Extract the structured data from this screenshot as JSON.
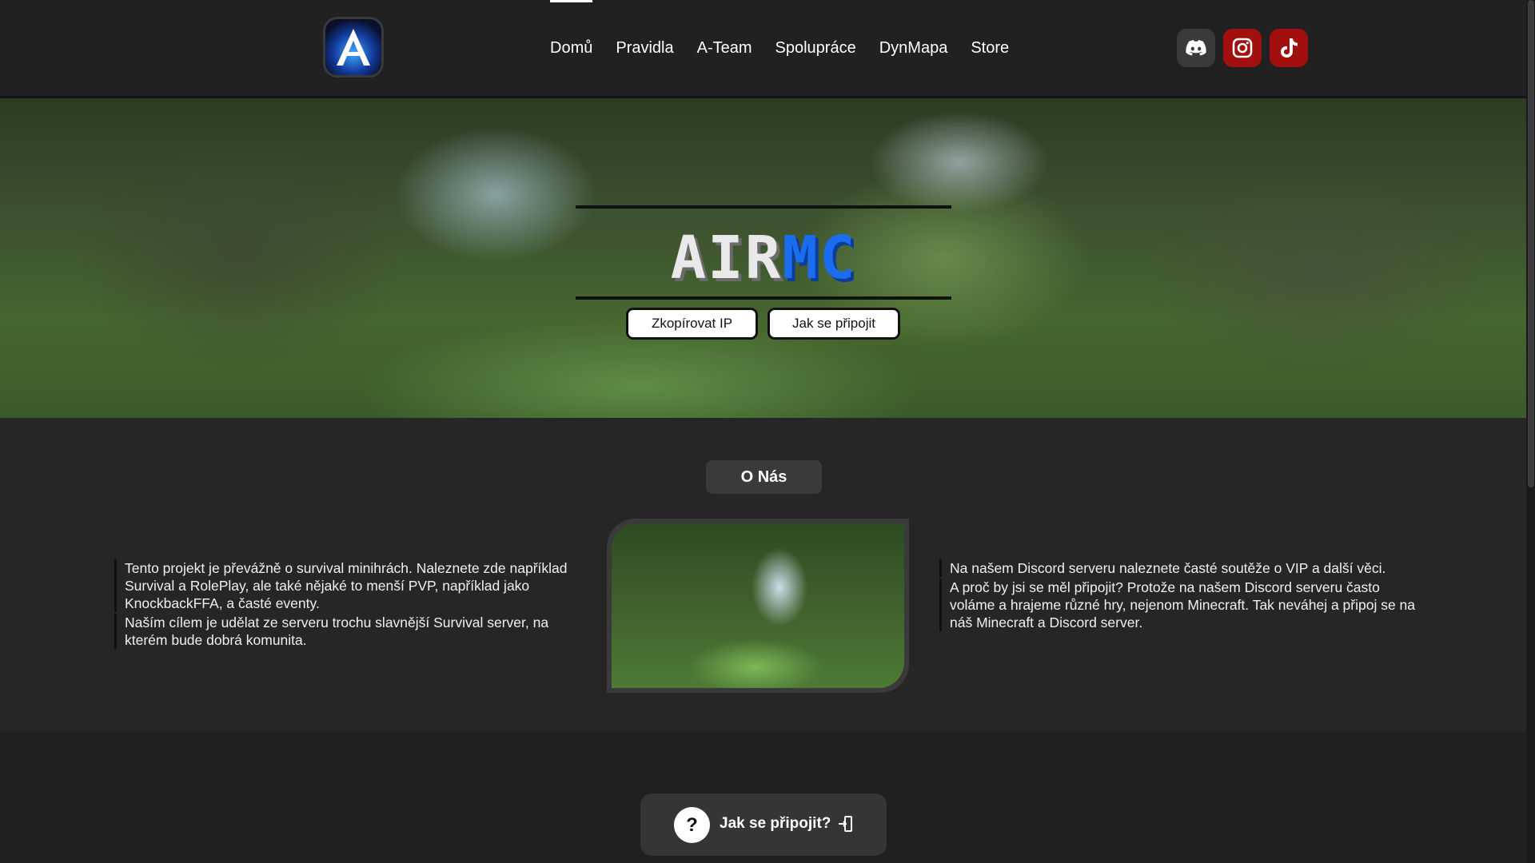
{
  "nav": {
    "items": [
      {
        "label": "Domů",
        "active": true
      },
      {
        "label": "Pravidla"
      },
      {
        "label": "A-Team"
      },
      {
        "label": "Spolupráce"
      },
      {
        "label": "DynMapa"
      },
      {
        "label": "Store"
      }
    ]
  },
  "social": {
    "icons": [
      "discord-icon",
      "instagram-icon",
      "tiktok-icon"
    ],
    "colors": {
      "discord": "#3a3a3a",
      "instagram": "#a10f0f",
      "tiktok": "#a10f0f"
    }
  },
  "hero": {
    "title_part1": "AIR",
    "title_part2": "MC",
    "copy_ip_label": "Zkopírovat IP",
    "how_to_join_label": "Jak se připojit"
  },
  "about": {
    "badge": "O Nás",
    "left": [
      "Tento projekt je převážně o survival minihrách. Naleznete zde například Survival a RolePlay, ale také nějaké to menší PVP, například jako KnockbackFFA, a časté eventy.",
      "Naším cílem je udělat ze serveru trochu slavnější Survival server, na kterém bude dobrá komunita."
    ],
    "right": [
      "Na našem Discord serveru naleznete časté soutěže o VIP a další věci.",
      "A proč by jsi se měl připojit? Protože na našem Discord serveru často voláme a hrajeme různé hry, nejenom Minecraft. Tak neváhej a připoj se na náš Minecraft a Discord server."
    ]
  },
  "help": {
    "symbol": "?",
    "label": "Jak se připojit?"
  },
  "colors": {
    "accent_blue": "#1b6df0",
    "social_red": "#a10f0f",
    "background": "#232323"
  }
}
